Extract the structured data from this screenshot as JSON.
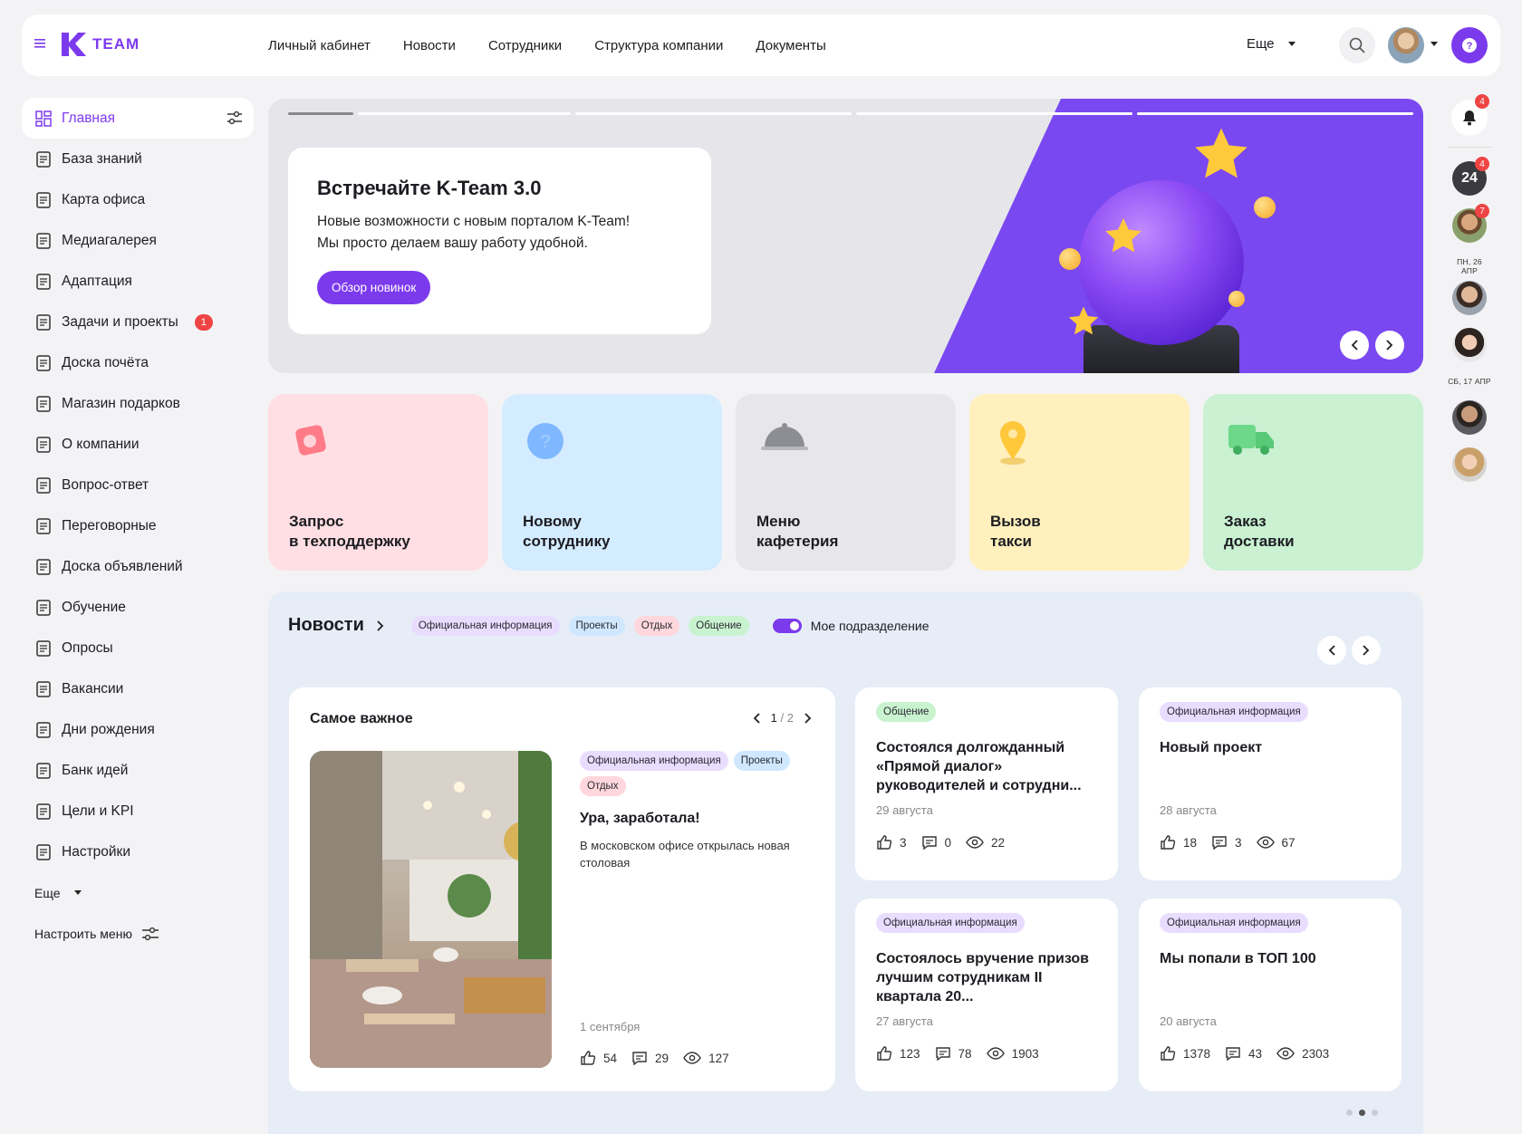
{
  "app": {
    "logo_text": "TEAM",
    "accent": "#7c3aed"
  },
  "topnav": [
    "Личный кабинет",
    "Новости",
    "Сотрудники",
    "Структура компании",
    "Документы"
  ],
  "header": {
    "more_label": "Еще"
  },
  "sidebar": {
    "items": [
      {
        "label": "Главная",
        "icon": "dashboard-icon"
      },
      {
        "label": "База знаний",
        "icon": "book-icon"
      },
      {
        "label": "Карта офиса",
        "icon": "building-icon"
      },
      {
        "label": "Медиагалерея",
        "icon": "image-icon"
      },
      {
        "label": "Адаптация",
        "icon": "hands-icon"
      },
      {
        "label": "Задачи и проекты",
        "icon": "tasks-icon",
        "badge": "1"
      },
      {
        "label": "Доска почёта",
        "icon": "user-star-icon"
      },
      {
        "label": "Магазин подарков",
        "icon": "gift-icon"
      },
      {
        "label": "О компании",
        "icon": "office-icon"
      },
      {
        "label": "Вопрос-ответ",
        "icon": "question-icon"
      },
      {
        "label": "Переговорные",
        "icon": "meeting-icon"
      },
      {
        "label": "Доска объявлений",
        "icon": "board-icon"
      },
      {
        "label": "Обучение",
        "icon": "learning-icon"
      },
      {
        "label": "Опросы",
        "icon": "poll-icon"
      },
      {
        "label": "Вакансии",
        "icon": "vacancy-icon"
      },
      {
        "label": "Дни рождения",
        "icon": "cake-icon"
      },
      {
        "label": "Банк идей",
        "icon": "bulb-icon"
      },
      {
        "label": "Цели и KPI",
        "icon": "target-icon"
      },
      {
        "label": "Настройки",
        "icon": "gear-icon"
      }
    ],
    "more_label": "Еще",
    "config_label": "Настроить меню"
  },
  "banner": {
    "title": "Встречайте K-Team 3.0",
    "text_line1": "Новые возможности с новым порталом K-Team!",
    "text_line2": "Мы просто делаем вашу работу удобной.",
    "button": "Обзор новинок"
  },
  "tiles": [
    {
      "label": "Запрос\nв техподдержку",
      "bg": "#ffdfe3",
      "icon": "support-icon"
    },
    {
      "label": "Новому\nсотруднику",
      "bg": "#d4ecff",
      "icon": "question-bubble-icon"
    },
    {
      "label": "Меню\nкафетерия",
      "bg": "#e7e7ea",
      "icon": "cloche-icon"
    },
    {
      "label": "Вызов\nтакси",
      "bg": "#fff0bd",
      "icon": "location-pin-icon"
    },
    {
      "label": "Заказ\nдоставки",
      "bg": "#c9f1d2",
      "icon": "truck-icon"
    }
  ],
  "news": {
    "title": "Новости",
    "filters": [
      {
        "label": "Официальная информация",
        "color": "purple"
      },
      {
        "label": "Проекты",
        "color": "blue"
      },
      {
        "label": "Отдых",
        "color": "pink"
      },
      {
        "label": "Общение",
        "color": "green"
      }
    ],
    "toggle_label": "Мое подразделение",
    "featured": {
      "heading": "Самое важное",
      "page_current": "1",
      "page_sep": "/",
      "page_total": "2",
      "tags": [
        "Официальная информация",
        "Проекты",
        "Отдых"
      ],
      "title": "Ура, заработала!",
      "text": "В московском офисе открылась новая столовая",
      "date": "1 сентября",
      "likes": "54",
      "comments": "29",
      "views": "127"
    },
    "cards": [
      {
        "tag": "Общение",
        "tag_color": "green",
        "title": "Состоялся долгожданный «Прямой диалог» руководителей и сотрудни...",
        "date": "29 августа",
        "likes": "3",
        "comments": "0",
        "views": "22"
      },
      {
        "tag": "Официальная информация",
        "tag_color": "purple",
        "title": "Новый проект",
        "date": "28 августа",
        "likes": "18",
        "comments": "3",
        "views": "67"
      },
      {
        "tag": "Официальная информация",
        "tag_color": "purple",
        "title": "Состоялось вручение призов лучшим сотрудникам II квартала 20...",
        "date": "27 августа",
        "likes": "123",
        "comments": "78",
        "views": "1903"
      },
      {
        "tag": "Официальная информация",
        "tag_color": "purple",
        "title": "Мы попали в ТОП 100",
        "date": "20 августа",
        "likes": "1378",
        "comments": "43",
        "views": "2303"
      }
    ]
  },
  "rail": {
    "bell_badge": "4",
    "cal_label": "24",
    "cal_badge": "4",
    "av1_badge": "7",
    "date1": "ПН, 26 АПР",
    "date2": "СБ, 17 АПР"
  }
}
